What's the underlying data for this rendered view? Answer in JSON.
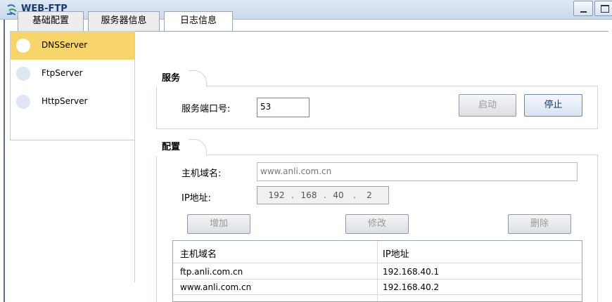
{
  "window": {
    "title": "WEB-FTP"
  },
  "tabs": [
    {
      "label": "基础配置"
    },
    {
      "label": "服务器信息"
    },
    {
      "label": "日志信息"
    }
  ],
  "servers": [
    {
      "label": "DNSServer",
      "selected": true
    },
    {
      "label": "FtpServer",
      "selected": false
    },
    {
      "label": "HttpServer",
      "selected": false
    }
  ],
  "service": {
    "section_title": "服务",
    "port_label": "服务端口号:",
    "port_value": "53",
    "start_label": "启动",
    "stop_label": "停止"
  },
  "config": {
    "section_title": "配置",
    "host_label": "主机域名:",
    "host_value": "www.anli.com.cn",
    "ip_label": "IP地址:",
    "ip": [
      "192",
      "168",
      "40",
      "2"
    ],
    "add_label": "增加",
    "modify_label": "修改",
    "delete_label": "删除"
  },
  "table": {
    "headers": [
      "主机域名",
      "IP地址"
    ],
    "rows": [
      [
        "ftp.anli.com.cn",
        "192.168.40.1"
      ],
      [
        "www.anli.com.cn",
        "192.168.40.2"
      ]
    ]
  },
  "colors": {
    "selected_item": "#f7d56a",
    "titlebar": "#c9d9ec",
    "title_text": "#1b3a6b"
  }
}
